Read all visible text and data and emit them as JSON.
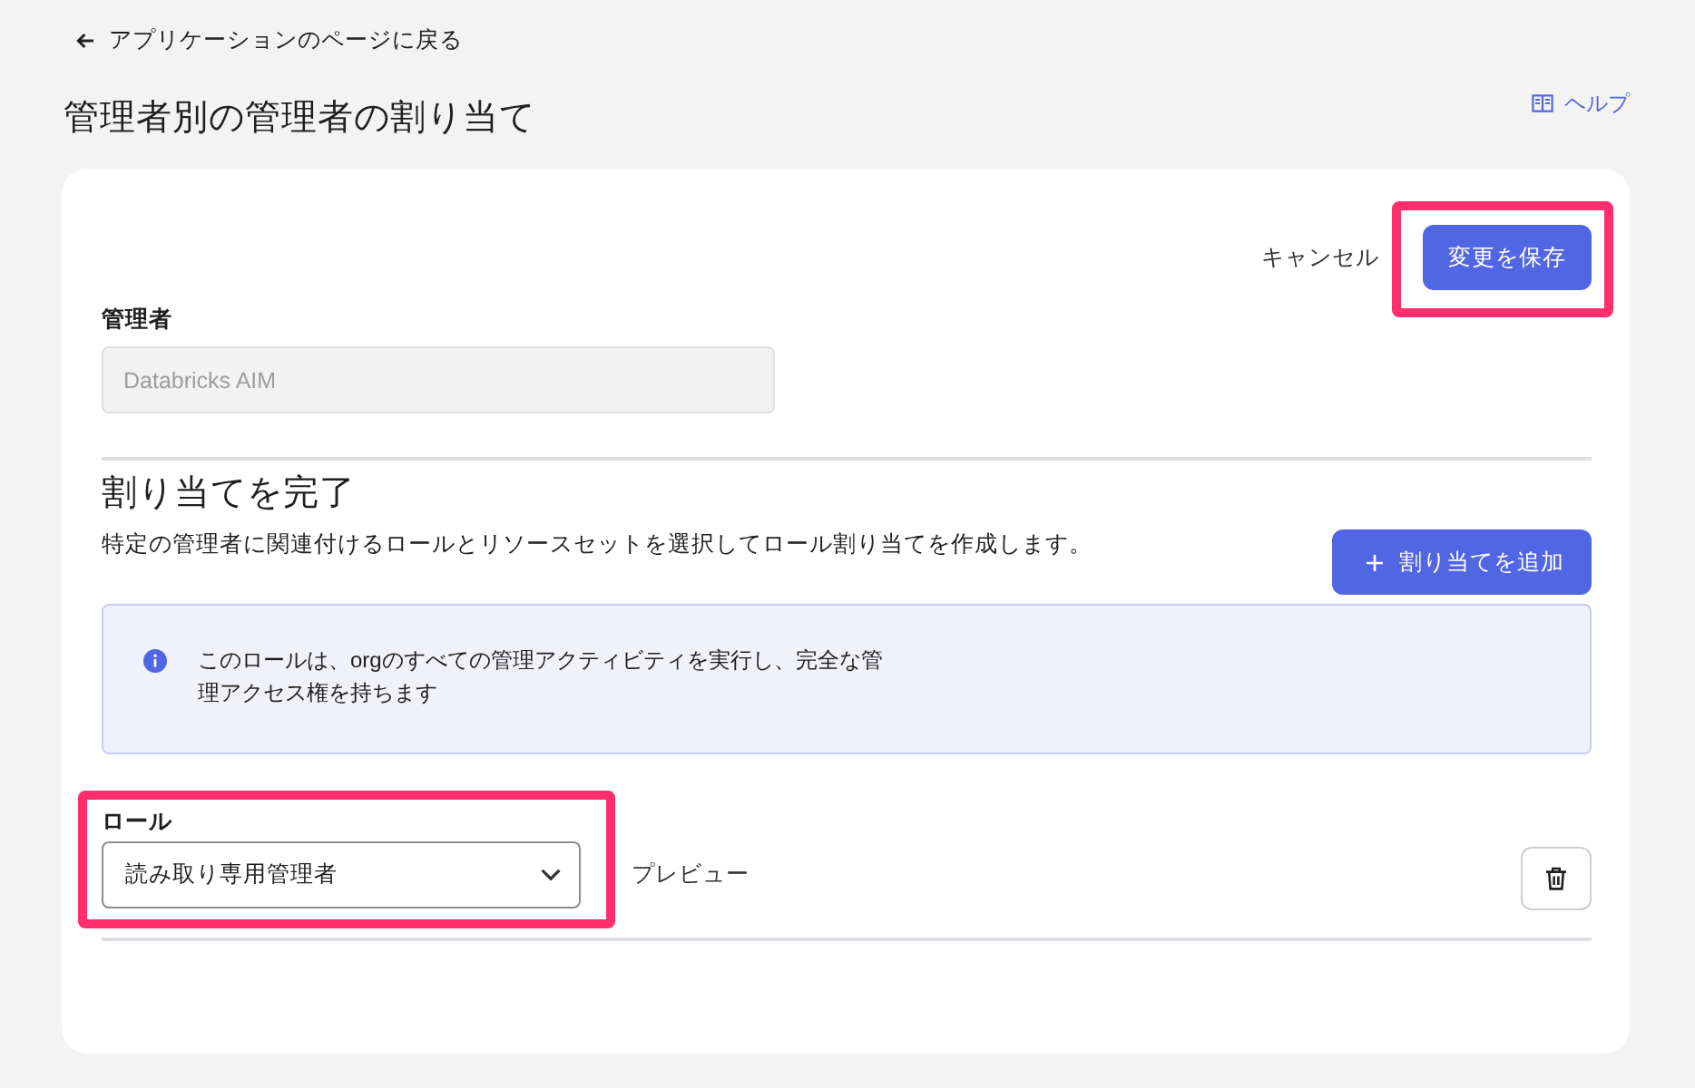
{
  "back_link": {
    "label": "アプリケーションのページに戻る"
  },
  "page_title": "管理者別の管理者の割り当て",
  "help_link": {
    "label": "ヘルプ"
  },
  "actions": {
    "cancel": "キャンセル",
    "save": {
      "label": "変更を保存",
      "highlighted": true
    }
  },
  "admin_field": {
    "label": "管理者",
    "value": "Databricks AIM",
    "disabled": true
  },
  "assignment_section": {
    "title": "割り当てを完了",
    "description": "特定の管理者に関連付けるロールとリソースセットを選択してロール割り当てを作成します。",
    "add_button": {
      "label": "割り当てを追加"
    }
  },
  "info_box": {
    "text": "このロールは、orgのすべての管理アクティビティを実行し、完全な管理アクセス権を持ちます"
  },
  "assignments": [
    {
      "role_label": "ロール",
      "role": "読み取り専用管理者",
      "preview": "プレビュー",
      "highlighted": true
    }
  ]
}
